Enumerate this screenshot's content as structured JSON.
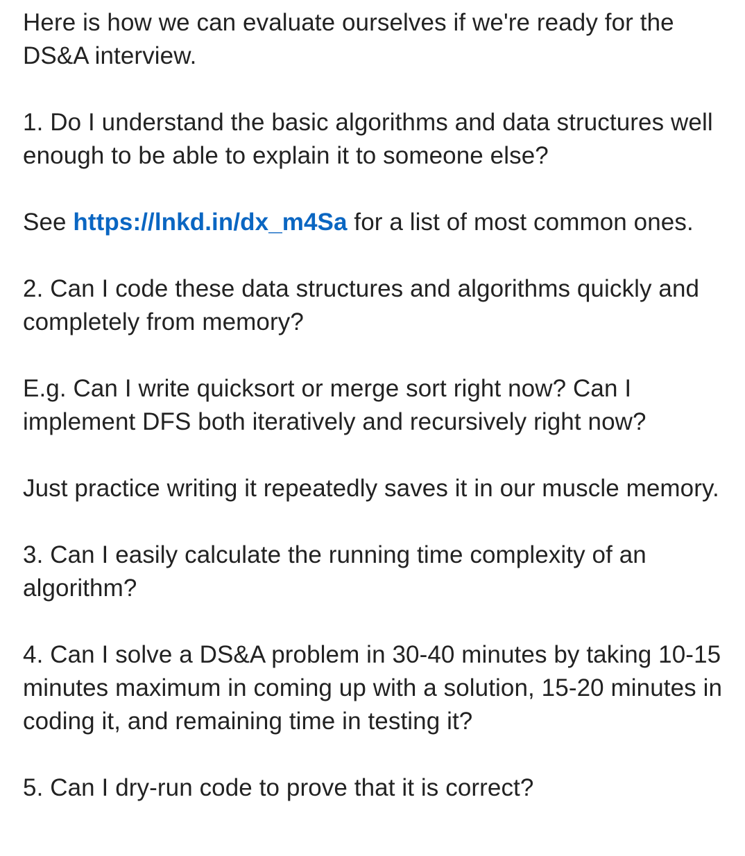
{
  "post": {
    "intro": "Here is how we can evaluate ourselves if we're ready for the DS&A interview.",
    "q1": "1. Do I understand the basic algorithms and data structures well enough to be able to explain it to someone else?",
    "see_prefix": "See ",
    "see_link": "https://lnkd.in/dx_m4Sa",
    "see_suffix": " for a list of most common ones.",
    "q2": "2. Can I code these data structures and algorithms quickly and completely from memory?",
    "example": "E.g. Can I write quicksort or merge sort right now? Can I implement DFS both iteratively and recursively right now?",
    "practice": "Just practice writing it repeatedly saves it in our muscle memory.",
    "q3": "3. Can I easily calculate the running time complexity of an algorithm?",
    "q4": "4. Can I solve a DS&A problem in 30-40 minutes by taking 10-15 minutes maximum in coming up with a solution, 15-20 minutes in coding it, and remaining time in testing it?",
    "q5": "5. Can I dry-run code to prove that it is correct?"
  },
  "colors": {
    "text": "#222222",
    "link": "#0a66c2",
    "background": "#ffffff"
  }
}
